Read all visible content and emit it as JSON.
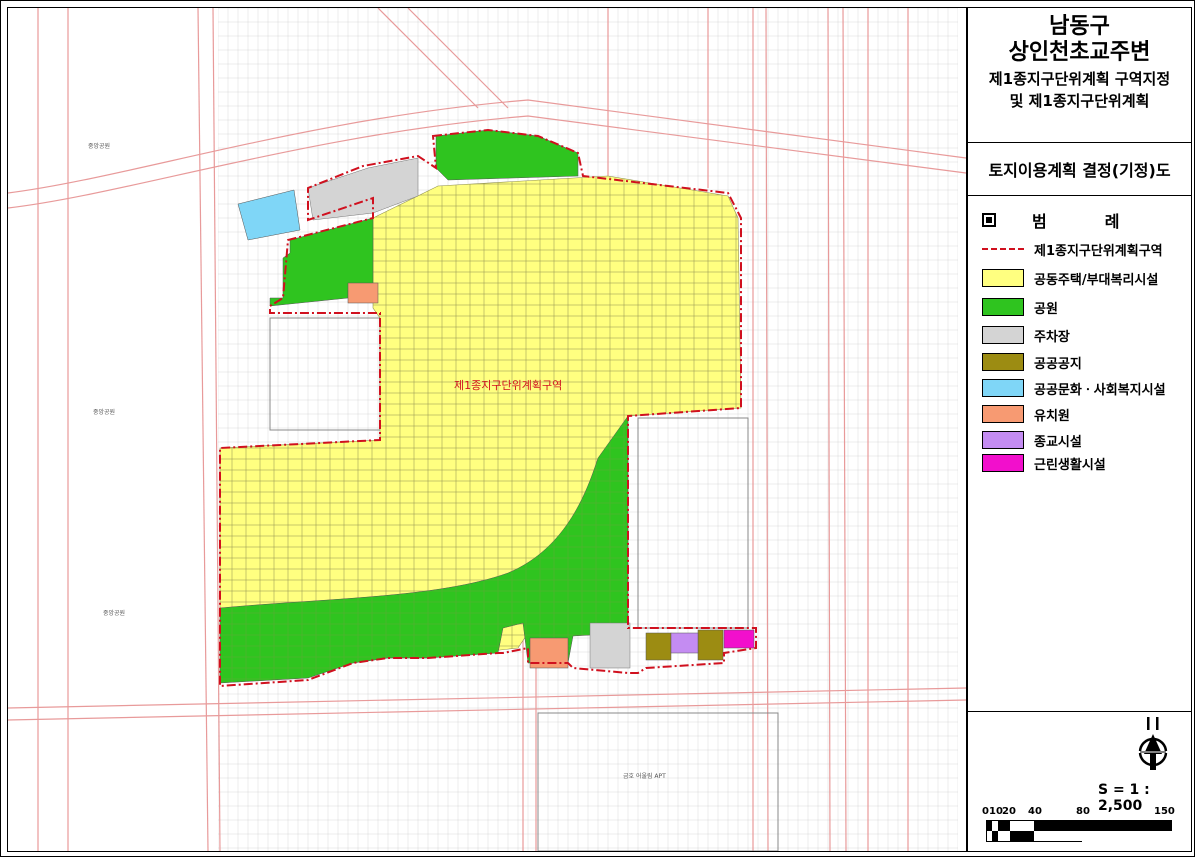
{
  "title": {
    "line1": "남동구",
    "line2": "상인천초교주변",
    "line3": "제1종지구단위계획 구역지정",
    "line4": "및 제1종지구단위계획"
  },
  "subtitle": "토지이용계획 결정(기정)도",
  "legend": {
    "heading_a": "범",
    "heading_b": "례",
    "items": [
      {
        "label": "제1종지구단위계획구역",
        "color": "#d0101e",
        "kind": "line"
      },
      {
        "label": "공동주택/부대복리시설",
        "color": "#ffff80",
        "kind": "fill"
      },
      {
        "label": "공원",
        "color": "#2fc41f",
        "kind": "fill"
      },
      {
        "label": "주차장",
        "color": "#d4d4d4",
        "kind": "fill"
      },
      {
        "label": "공공공지",
        "color": "#9c8c12",
        "kind": "fill"
      },
      {
        "label": "공공문화ㆍ사회복지시설",
        "color": "#7fd6f7",
        "kind": "fill"
      },
      {
        "label": "유치원",
        "color": "#f79a72",
        "kind": "fill"
      },
      {
        "label": "종교시설",
        "color": "#c48cf2",
        "kind": "fill"
      },
      {
        "label": "근린생활시설",
        "color": "#f20fcc",
        "kind": "fill"
      }
    ]
  },
  "map": {
    "district_label": "제1종지구단위계획구역",
    "small_labels": [
      "중앙공원",
      "중앙공원",
      "중앙공원",
      "금호 어울림 APT"
    ]
  },
  "scale": {
    "text": "S = 1 : 2,500",
    "ticks": [
      "0",
      "10",
      "20",
      "40",
      "80",
      "150"
    ]
  },
  "colors": {
    "boundary": "#d0101e",
    "road": "#e89a9a",
    "residential": "#ffff80",
    "park": "#2fc41f"
  }
}
